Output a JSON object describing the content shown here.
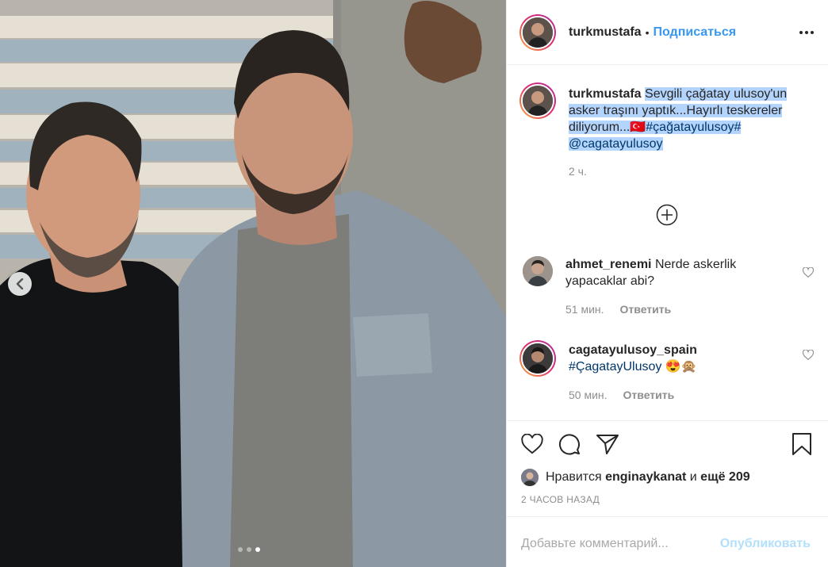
{
  "post": {
    "username": "turkmustafa",
    "separator": "•",
    "follow_label": "Подписаться"
  },
  "caption": {
    "username": "turkmustafa",
    "text_part1": "Sevgili çağatay ulusoy'un asker traşını yaptık...Hayırlı teskereler diliyorum...",
    "flag": "🇹🇷",
    "hashtag": "#çağatayulusoy#",
    "mention": "@cagatayulusoy",
    "time": "2 ч."
  },
  "comments": [
    {
      "username": "ahmet_renemi",
      "text": "Nerde askerlik yapacaklar abi?",
      "time": "51 мин.",
      "reply_label": "Ответить"
    },
    {
      "username": "cagatayulusoy_spain",
      "hashtag": "#ÇagatayUlusoy",
      "emoji": "😍🙊",
      "time": "50 мин.",
      "reply_label": "Ответить"
    }
  ],
  "likes": {
    "prefix": "Нравится",
    "user": "enginaykanat",
    "conjunction": "и",
    "others": "ещё 209"
  },
  "posted_ago": "2 ЧАСОВ НАЗАД",
  "comment_box": {
    "placeholder": "Добавьте комментарий...",
    "publish_label": "Опубликовать"
  },
  "carousel": {
    "count": 3,
    "active": 2
  },
  "colors": {
    "link": "#3897f0",
    "selection": "#b3d4fc",
    "hashtag": "#00376b",
    "muted": "#8e8e8e"
  }
}
